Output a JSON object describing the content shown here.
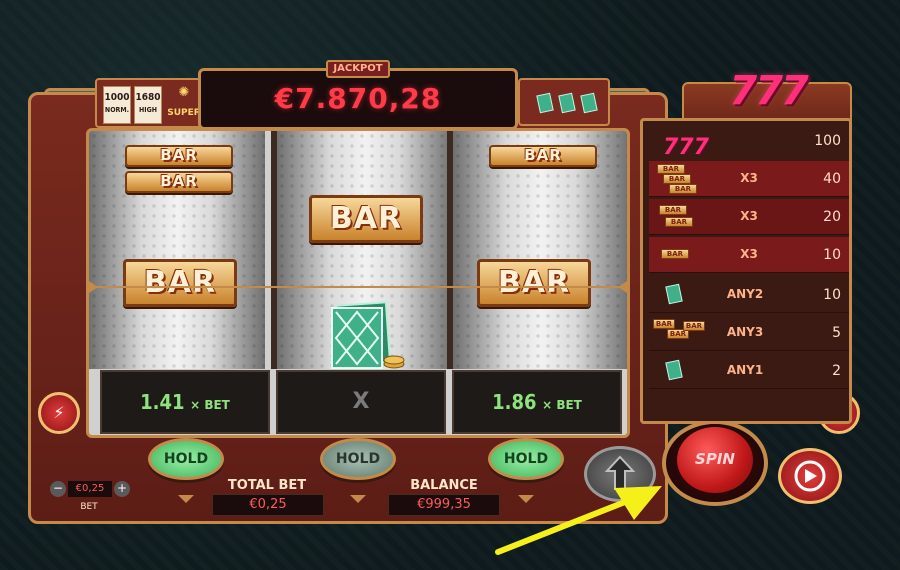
{
  "jackpot": {
    "label": "JACKPOT",
    "value": "€7.870,28"
  },
  "levels": [
    {
      "value": "1000",
      "sub": "NORM."
    },
    {
      "value": "1680",
      "sub": "HIGH"
    },
    {
      "value": "",
      "sub": "SUPER"
    }
  ],
  "reels": {
    "reel1": {
      "top": "BAR",
      "top2": "BAR",
      "center": "BAR"
    },
    "reel2": {
      "top": "BAR"
    },
    "reel3": {
      "top": "BAR",
      "center": "BAR"
    }
  },
  "multipliers": [
    {
      "value": "1.41",
      "unit": "× BET"
    },
    {
      "value": "X",
      "unit": ""
    },
    {
      "value": "1.86",
      "unit": "× BET"
    }
  ],
  "hold_buttons": [
    "HOLD",
    "HOLD",
    "HOLD"
  ],
  "total_bet": {
    "label": "TOTAL BET",
    "value": "€0,25"
  },
  "balance": {
    "label": "BALANCE",
    "value": "€999,35"
  },
  "bet_selector": {
    "value": "€0,25",
    "label": "BET",
    "minus": "−",
    "plus": "+"
  },
  "spin": {
    "label": "SPIN"
  },
  "logo": "777",
  "paytable": {
    "top": {
      "symbol": "777",
      "value": "100"
    },
    "rows": [
      {
        "symbol": "BAR x3 stack",
        "label": "X3",
        "value": "40"
      },
      {
        "symbol": "BAR x2 stack",
        "label": "X3",
        "value": "20"
      },
      {
        "symbol": "BAR",
        "label": "X3",
        "value": "10"
      },
      {
        "symbol": "card",
        "label": "ANY2",
        "value": "10"
      },
      {
        "symbol": "mixed bars",
        "label": "ANY3",
        "value": "5"
      },
      {
        "symbol": "card",
        "label": "ANY1",
        "value": "2"
      }
    ]
  },
  "colors": {
    "accent": "#c48a4a",
    "jackpot": "#ff3b4a",
    "multiplier": "#8ee37a",
    "annotation": "#f6f01a"
  },
  "icons": {
    "lightning": "⚡",
    "menu": "≡",
    "turbo": "⇧",
    "autoplay": "▶"
  }
}
